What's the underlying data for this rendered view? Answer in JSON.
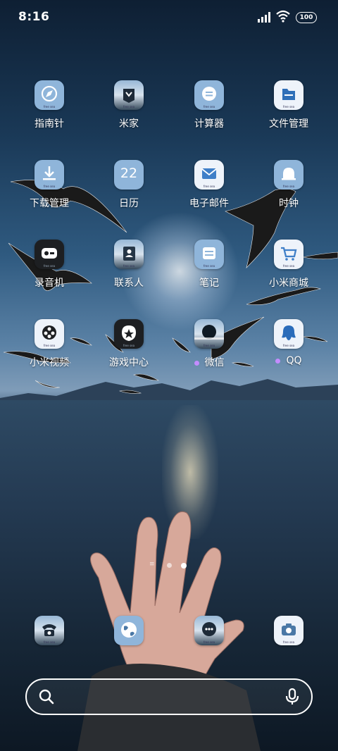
{
  "status_bar": {
    "time": "8:16",
    "battery": "100"
  },
  "apps": [
    {
      "id": "compass",
      "label": "指南针",
      "icon": "compass-icon"
    },
    {
      "id": "mijia",
      "label": "米家",
      "icon": "mijia-icon"
    },
    {
      "id": "calculator",
      "label": "计算器",
      "icon": "calculator-icon"
    },
    {
      "id": "file-manager",
      "label": "文件管理",
      "icon": "folder-icon"
    },
    {
      "id": "downloads",
      "label": "下载管理",
      "icon": "download-icon"
    },
    {
      "id": "calendar",
      "label": "日历",
      "icon": "calendar-icon",
      "day": "22"
    },
    {
      "id": "email",
      "label": "电子邮件",
      "icon": "mail-icon"
    },
    {
      "id": "clock",
      "label": "时钟",
      "icon": "alarm-clock-icon"
    },
    {
      "id": "recorder",
      "label": "录音机",
      "icon": "recorder-icon"
    },
    {
      "id": "contacts",
      "label": "联系人",
      "icon": "contacts-icon"
    },
    {
      "id": "notes",
      "label": "笔记",
      "icon": "notes-icon"
    },
    {
      "id": "mi-store",
      "label": "小米商城",
      "icon": "shopping-cart-icon"
    },
    {
      "id": "mi-video",
      "label": "小米视频",
      "icon": "video-reel-icon"
    },
    {
      "id": "game-center",
      "label": "游戏中心",
      "icon": "game-center-icon"
    },
    {
      "id": "wechat",
      "label": "微信",
      "icon": "wechat-icon"
    },
    {
      "id": "qq",
      "label": "QQ",
      "icon": "qq-penguin-icon"
    }
  ],
  "dock": [
    {
      "id": "phone",
      "icon": "telephone-icon"
    },
    {
      "id": "browser",
      "icon": "globe-icon"
    },
    {
      "id": "messages",
      "icon": "chat-bubble-icon"
    },
    {
      "id": "camera",
      "icon": "camera-icon"
    }
  ],
  "icon_tag": "free sea",
  "search_bar": {
    "search_icon": "search-icon",
    "mic_icon": "microphone-icon"
  },
  "pager": {
    "pages": 3,
    "current": 3
  },
  "colors": {
    "new_badge": "#c48cff"
  }
}
